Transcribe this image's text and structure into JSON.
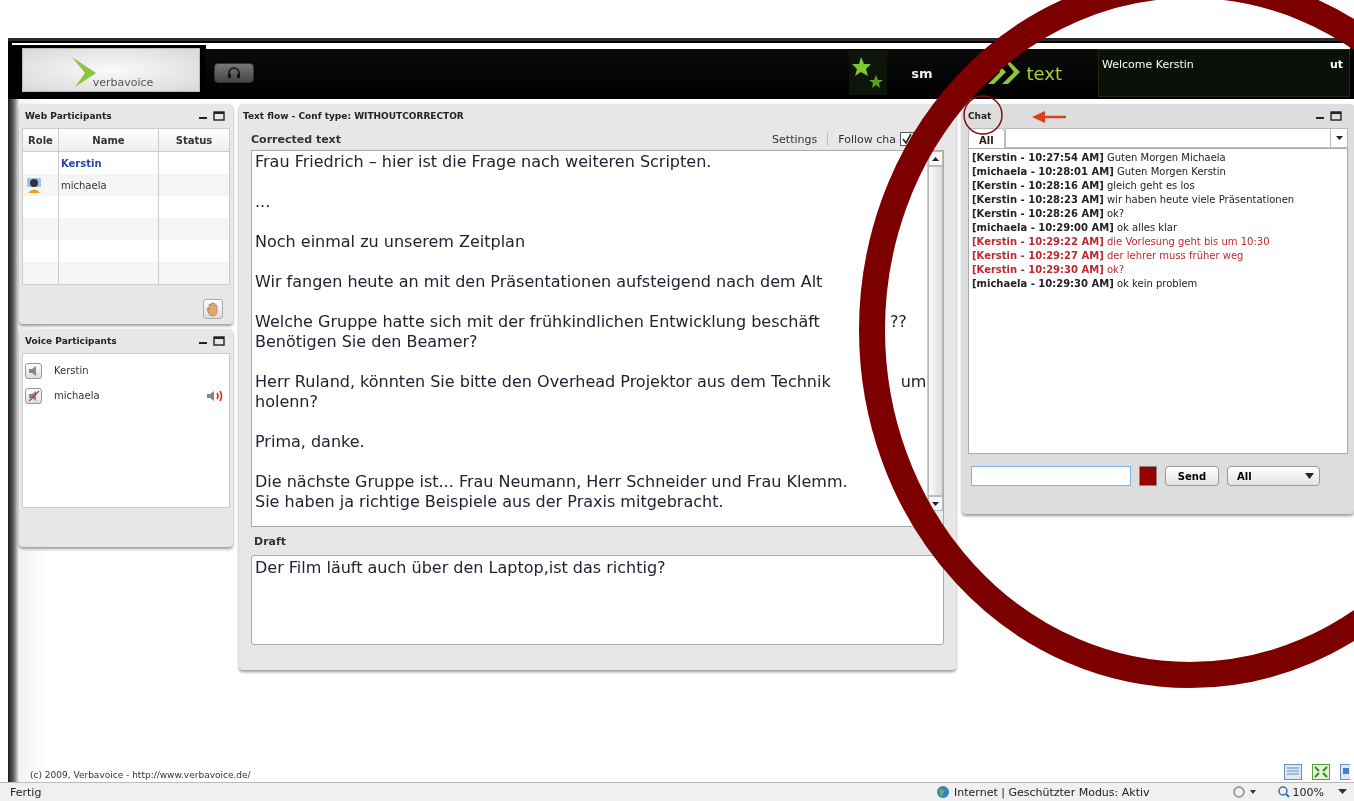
{
  "header": {
    "logo": "verbavoice",
    "brand_fragment": "sm",
    "brand_text": "text",
    "welcome": "Welcome Kerstin",
    "logout_fragment": "ut"
  },
  "web_participants": {
    "title": "Web Participants",
    "columns": [
      "Role",
      "Name",
      "Status"
    ],
    "rows": [
      {
        "name": "Kerstin",
        "selected": true,
        "role_icon": false
      },
      {
        "name": "michaela",
        "selected": false,
        "role_icon": true
      }
    ]
  },
  "voice_participants": {
    "title": "Voice Participants",
    "rows": [
      {
        "name": "Kerstin",
        "muted": false,
        "speaking": false
      },
      {
        "name": "michaela",
        "muted": true,
        "speaking": true
      }
    ]
  },
  "text_flow": {
    "title": "Text flow - Conf type: WITHOUTCORRECTOR",
    "corrected_label": "Corrected text",
    "settings": "Settings",
    "follow_changes": "Follow cha",
    "follow_checked": true,
    "paragraphs": [
      {
        "lines": [
          {
            "text": "Frau Friedrich – hier ist die Frage nach weiteren Scripten."
          }
        ]
      },
      {
        "lines": [
          {
            "text": "..."
          }
        ]
      },
      {
        "lines": [
          {
            "text": "Noch einmal zu unserem Zeitplan"
          }
        ]
      },
      {
        "lines": [
          {
            "text": "Wir fangen heute an mit den Präsentationen aufsteigend nach dem Alt"
          }
        ]
      },
      {
        "lines": [
          {
            "text": "Welche Gruppe hatte sich mit der frühkindlichen Entwicklung beschäft",
            "after": "??"
          },
          {
            "text": "Benötigen Sie den Beamer?"
          }
        ]
      },
      {
        "lines": [
          {
            "text": "Herr Ruland, könnten Sie bitte den Overhead Projektor aus dem Technik",
            "after": "um"
          },
          {
            "text": "holenn?"
          }
        ]
      },
      {
        "lines": [
          {
            "text": "Prima, danke."
          }
        ]
      },
      {
        "lines": [
          {
            "text": "Die nächste Gruppe ist... Frau Neumann, Herr Schneider und Frau Klemm."
          },
          {
            "text": "Sie haben ja richtige Beispiele aus der Praxis mitgebracht."
          }
        ]
      }
    ],
    "draft_label": "Draft",
    "draft": "Der Film läuft auch über den Laptop,ist das richtig?"
  },
  "chat": {
    "title": "Chat",
    "tabs": [
      {
        "label": "All",
        "selected": true
      }
    ],
    "messages": [
      {
        "author": "[Kerstin - 10:27:54 AM]",
        "text": "Guten Morgen Michaela",
        "color": "#222222"
      },
      {
        "author": "[michaela - 10:28:01 AM]",
        "text": "Guten Morgen Kerstin",
        "color": "#222222"
      },
      {
        "author": "[Kerstin - 10:28:16 AM]",
        "text": "gleich geht es los",
        "color": "#222222"
      },
      {
        "author": "[Kerstin - 10:28:23 AM]",
        "text": "wir haben heute viele Präsentationen",
        "color": "#222222"
      },
      {
        "author": "[Kerstin - 10:28:26 AM]",
        "text": "ok?",
        "color": "#222222"
      },
      {
        "author": "[michaela - 10:29:00 AM]",
        "text": "ok alles klar",
        "color": "#222222"
      },
      {
        "author": "[Kerstin - 10:29:22 AM]",
        "text": "die Vorlesung geht bis um 10:30",
        "color": "#c0282d"
      },
      {
        "author": "[Kerstin - 10:29:27 AM]",
        "text": "der lehrer muss früher weg",
        "color": "#c0282d"
      },
      {
        "author": "[Kerstin - 10:29:30 AM]",
        "text": "ok?",
        "color": "#c0282d"
      },
      {
        "author": "[michaela - 10:29:30 AM]",
        "text": "ok kein problem",
        "color": "#222222"
      }
    ],
    "color_picker": {
      "color": "#990000"
    },
    "send": "Send",
    "recipient": "All"
  },
  "footer": "(c) 2009, Verbavoice - http://www.verbavoice.de/",
  "status_bar": {
    "status": "Fertig",
    "zone": "Internet | Geschützter Modus: Aktiv",
    "zoom": "100%"
  }
}
